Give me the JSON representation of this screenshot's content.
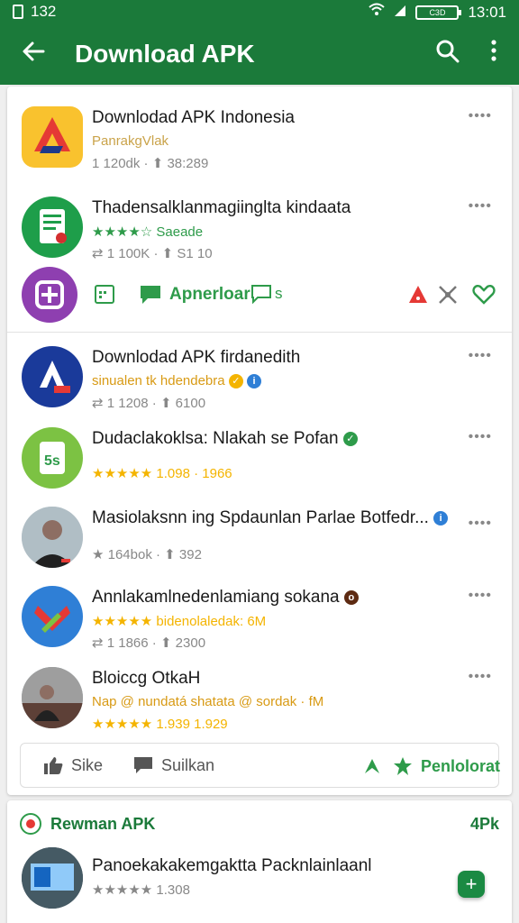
{
  "status": {
    "left_text": "132",
    "time": "13:01",
    "battery_text": "C3D"
  },
  "appbar": {
    "title": "Download APK",
    "back_icon": "arrow-left-icon",
    "search_icon": "search-icon",
    "more_icon": "more-vertical-icon"
  },
  "colors": {
    "primary": "#1b7a3a",
    "accent": "#1b8a43",
    "star": "#f4b400"
  },
  "top_card": {
    "items": [
      {
        "name": "Downlodad APK Indonesia",
        "sub": "PanrakgVlak",
        "meta": "1 120dk · ⬆ 38:289"
      },
      {
        "name": "Thadensalklanmagiinglta kindaata",
        "sub": "★★★★☆ Saeade",
        "meta": "⇄ 1 100K · ⬆ S1 10"
      }
    ],
    "action_label": "Apnerloar",
    "action_suffix": "s"
  },
  "list": [
    {
      "name": "Downlodad APK firdanedith",
      "sub": "sinualen tk  hdendebra",
      "meta": "⇄ 1 1208 · ⬆ 6100"
    },
    {
      "name": "Dudaclakoklsa: Nlakah se Pofan",
      "sub": "★★★★★ 1.098 · 1966",
      "meta": ""
    },
    {
      "name": "Masiolaksnn ing Spdaunlan Parlae Botfedr...",
      "sub": "",
      "meta": "★ 164bok · ⬆ 392"
    },
    {
      "name": "Annlakamlnedenlamiang sokana",
      "sub": "★★★★★ bidenolaledak: 6M",
      "meta": "⇄ 1 1866 · ⬆ 2300"
    },
    {
      "name": "Bloiccg OtkaH",
      "sub": "Nap @ nundatá shatata @ sordak · fM",
      "meta": "★★★★★ 1.939 1.929"
    }
  ],
  "footer": {
    "like_label": "Sike",
    "suggest_label": "Suilkan",
    "right_label": "Penlolorat"
  },
  "section2": {
    "title": "Rewman APK",
    "count": "4Pk",
    "item_name": "Panoekakakemgaktta Packnlainlaanl",
    "item_meta": "★★★★★ 1.308"
  }
}
